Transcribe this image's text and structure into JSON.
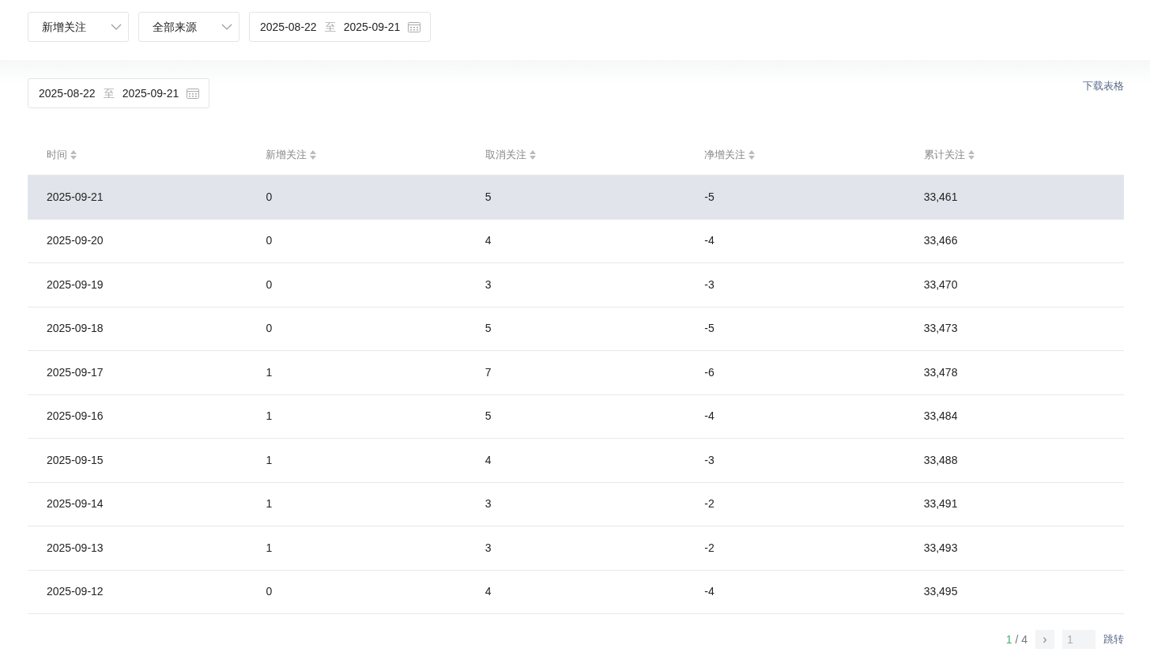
{
  "filters": {
    "type_select": "新增关注",
    "source_select": "全部来源",
    "date_range": {
      "start": "2025-08-22",
      "separator": "至",
      "end": "2025-09-21"
    }
  },
  "table_date_range": {
    "start": "2025-08-22",
    "separator": "至",
    "end": "2025-09-21"
  },
  "download_link": "下载表格",
  "table": {
    "columns": [
      "时间",
      "新增关注",
      "取消关注",
      "净增关注",
      "累计关注"
    ],
    "rows": [
      {
        "cells": [
          "2025-09-21",
          "0",
          "5",
          "-5",
          "33,461"
        ],
        "highlighted": true
      },
      {
        "cells": [
          "2025-09-20",
          "0",
          "4",
          "-4",
          "33,466"
        ],
        "highlighted": false
      },
      {
        "cells": [
          "2025-09-19",
          "0",
          "3",
          "-3",
          "33,470"
        ],
        "highlighted": false
      },
      {
        "cells": [
          "2025-09-18",
          "0",
          "5",
          "-5",
          "33,473"
        ],
        "highlighted": false
      },
      {
        "cells": [
          "2025-09-17",
          "1",
          "7",
          "-6",
          "33,478"
        ],
        "highlighted": false
      },
      {
        "cells": [
          "2025-09-16",
          "1",
          "5",
          "-4",
          "33,484"
        ],
        "highlighted": false
      },
      {
        "cells": [
          "2025-09-15",
          "1",
          "4",
          "-3",
          "33,488"
        ],
        "highlighted": false
      },
      {
        "cells": [
          "2025-09-14",
          "1",
          "3",
          "-2",
          "33,491"
        ],
        "highlighted": false
      },
      {
        "cells": [
          "2025-09-13",
          "1",
          "3",
          "-2",
          "33,493"
        ],
        "highlighted": false
      },
      {
        "cells": [
          "2025-09-12",
          "0",
          "4",
          "-4",
          "33,495"
        ],
        "highlighted": false
      }
    ]
  },
  "pagination": {
    "current": "1",
    "separator": "/",
    "total": "4",
    "next": "›",
    "page_input": "1",
    "jump": "跳转"
  }
}
